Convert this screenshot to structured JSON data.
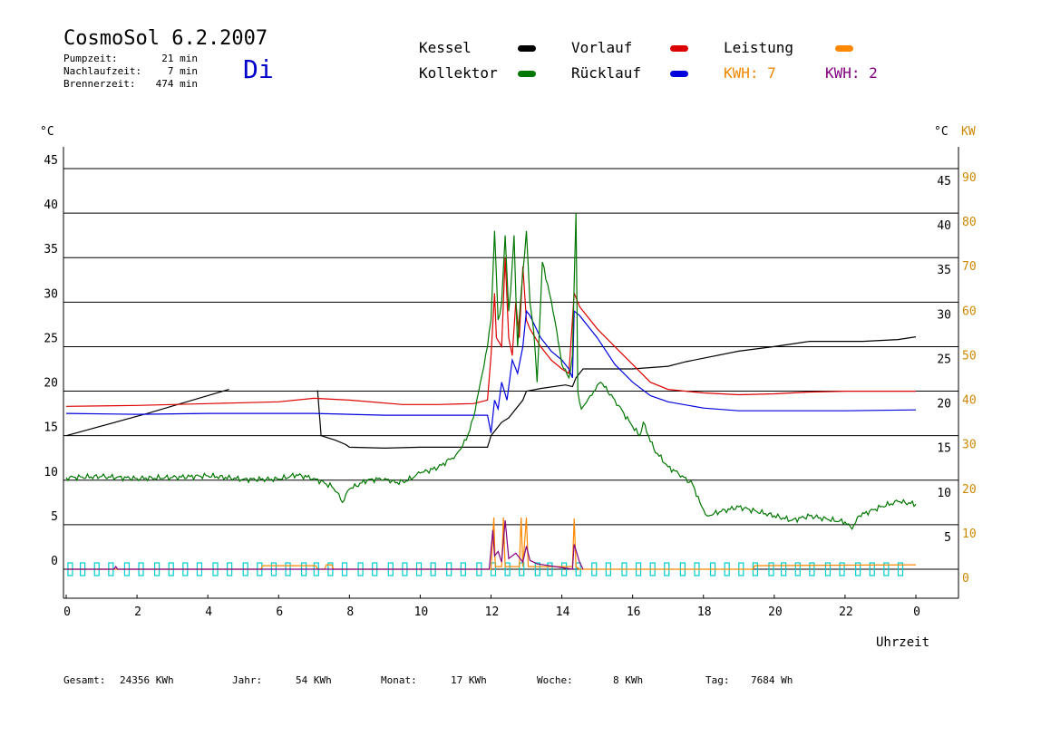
{
  "header": {
    "title": "CosmoSol 6.2.2007",
    "day": "Di",
    "stats": [
      {
        "label": "Pumpzeit:",
        "value": "21 min"
      },
      {
        "label": "Nachlaufzeit:",
        "value": "7 min"
      },
      {
        "label": "Brennerzeit:",
        "value": "474 min"
      }
    ]
  },
  "legend": {
    "items": [
      {
        "label": "Kessel",
        "color": "#000000"
      },
      {
        "label": "Vorlauf",
        "color": "#dd0000"
      },
      {
        "label": "Leistung",
        "color": "#ff8800"
      },
      {
        "label": "Kollektor",
        "color": "#007700"
      },
      {
        "label": "Rücklauf",
        "color": "#0000dd"
      }
    ],
    "kwh1": "KWH: 7",
    "kwh1_color": "#ee8800",
    "kwh2": "KWH: 2",
    "kwh2_color": "#800080"
  },
  "footer": [
    {
      "label": "Gesamt:",
      "value": "24356 KWh"
    },
    {
      "label": "Jahr:",
      "value": "54 KWh"
    },
    {
      "label": "Monat:",
      "value": "17 KWh"
    },
    {
      "label": "Woche:",
      "value": "8 KWh"
    },
    {
      "label": "Tag:",
      "value": "7684 Wh"
    }
  ],
  "chart_data": {
    "type": "line",
    "xlabel": "Uhrzeit",
    "ylabel_left": "°C",
    "ylabel_right": "°C",
    "ylabel_right2": "KW",
    "xlim": [
      0,
      24
    ],
    "ylim": [
      0,
      45
    ],
    "x_ticks": [
      "0",
      "2",
      "4",
      "6",
      "8",
      "10",
      "12",
      "14",
      "16",
      "18",
      "20",
      "22",
      "0"
    ],
    "y_ticks_left": [
      "0",
      "5",
      "10",
      "15",
      "20",
      "25",
      "30",
      "35",
      "40",
      "45"
    ],
    "y_ticks_right": [
      "5",
      "10",
      "15",
      "20",
      "25",
      "30",
      "35",
      "40",
      "45"
    ],
    "y_ticks_kw": [
      "0",
      "10",
      "20",
      "30",
      "40",
      "50",
      "60",
      "70",
      "80",
      "90"
    ],
    "grid": true,
    "series": [
      {
        "name": "Kessel",
        "color": "#000000",
        "points": [
          [
            0,
            15
          ],
          [
            2.3,
            17.5
          ],
          [
            4.6,
            20.2
          ],
          [
            4.65,
            null
          ],
          [
            7.1,
            20.1
          ],
          [
            7.2,
            15
          ],
          [
            7.6,
            14.5
          ],
          [
            7.9,
            14
          ],
          [
            8.0,
            13.7
          ],
          [
            9,
            13.6
          ],
          [
            10,
            13.7
          ],
          [
            11,
            13.7
          ],
          [
            11.9,
            13.7
          ],
          [
            12.0,
            15
          ],
          [
            12.3,
            16.5
          ],
          [
            12.5,
            17
          ],
          [
            12.9,
            19
          ],
          [
            13.0,
            20
          ],
          [
            13.4,
            20.3
          ],
          [
            14.1,
            20.7
          ],
          [
            14.3,
            20.5
          ],
          [
            14.4,
            21.5
          ],
          [
            14.6,
            22.5
          ],
          [
            16,
            22.5
          ],
          [
            17,
            22.8
          ],
          [
            17.5,
            23.3
          ],
          [
            19,
            24.5
          ],
          [
            20,
            25
          ],
          [
            21,
            25.6
          ],
          [
            22.5,
            25.6
          ],
          [
            23.5,
            25.8
          ],
          [
            24,
            26.1
          ]
        ]
      },
      {
        "name": "Vorlauf",
        "color": "#dd0000",
        "points": [
          [
            0,
            18.3
          ],
          [
            2,
            18.4
          ],
          [
            4,
            18.6
          ],
          [
            6,
            18.8
          ],
          [
            7,
            19.2
          ],
          [
            8,
            19
          ],
          [
            9.5,
            18.5
          ],
          [
            10.5,
            18.5
          ],
          [
            11.5,
            18.6
          ],
          [
            11.9,
            19
          ],
          [
            12.0,
            24
          ],
          [
            12.1,
            31
          ],
          [
            12.15,
            26
          ],
          [
            12.3,
            25
          ],
          [
            12.4,
            35
          ],
          [
            12.5,
            26
          ],
          [
            12.6,
            24
          ],
          [
            12.7,
            30
          ],
          [
            12.8,
            26
          ],
          [
            12.9,
            34
          ],
          [
            13.0,
            28
          ],
          [
            13.1,
            27
          ],
          [
            13.4,
            25
          ],
          [
            13.7,
            23.5
          ],
          [
            14.0,
            22.5
          ],
          [
            14.2,
            22
          ],
          [
            14.35,
            31
          ],
          [
            14.5,
            29.5
          ],
          [
            15,
            27
          ],
          [
            15.5,
            25
          ],
          [
            16,
            23
          ],
          [
            16.5,
            21
          ],
          [
            17,
            20.2
          ],
          [
            18,
            19.8
          ],
          [
            19,
            19.6
          ],
          [
            20,
            19.7
          ],
          [
            21,
            19.9
          ],
          [
            22,
            20
          ],
          [
            24,
            20
          ]
        ]
      },
      {
        "name": "Rücklauf",
        "color": "#0000dd",
        "points": [
          [
            0,
            17.5
          ],
          [
            2,
            17.4
          ],
          [
            4,
            17.5
          ],
          [
            6,
            17.5
          ],
          [
            7,
            17.5
          ],
          [
            8,
            17.4
          ],
          [
            9,
            17.3
          ],
          [
            10,
            17.3
          ],
          [
            11.9,
            17.3
          ],
          [
            12.0,
            15.3
          ],
          [
            12.1,
            19
          ],
          [
            12.2,
            18
          ],
          [
            12.3,
            21
          ],
          [
            12.45,
            19
          ],
          [
            12.6,
            23.5
          ],
          [
            12.75,
            22
          ],
          [
            12.9,
            25
          ],
          [
            13.0,
            29
          ],
          [
            13.1,
            28.5
          ],
          [
            13.4,
            26
          ],
          [
            13.7,
            24.5
          ],
          [
            14.0,
            23.5
          ],
          [
            14.2,
            22.5
          ],
          [
            14.3,
            21.5
          ],
          [
            14.35,
            29
          ],
          [
            14.5,
            28.5
          ],
          [
            15,
            26
          ],
          [
            15.5,
            23
          ],
          [
            16,
            21
          ],
          [
            16.5,
            19.5
          ],
          [
            17,
            18.8
          ],
          [
            18,
            18.1
          ],
          [
            19,
            17.8
          ],
          [
            20,
            17.8
          ],
          [
            22,
            17.8
          ],
          [
            24,
            17.9
          ]
        ]
      },
      {
        "name": "Kollektor",
        "color": "#007700",
        "points": [
          [
            0,
            10.3
          ],
          [
            1,
            10.4
          ],
          [
            2,
            10.2
          ],
          [
            3,
            10.3
          ],
          [
            4,
            10.5
          ],
          [
            5,
            10.1
          ],
          [
            6,
            10.1
          ],
          [
            6.5,
            10.6
          ],
          [
            7,
            10.2
          ],
          [
            7.5,
            9.3
          ],
          [
            7.7,
            8.5
          ],
          [
            7.8,
            7.5
          ],
          [
            8,
            9
          ],
          [
            8.5,
            10
          ],
          [
            9,
            10.2
          ],
          [
            9.3,
            9.7
          ],
          [
            9.6,
            9.9
          ],
          [
            10,
            10.8
          ],
          [
            10.5,
            11.4
          ],
          [
            11,
            12.8
          ],
          [
            11.3,
            14.5
          ],
          [
            11.5,
            17
          ],
          [
            11.7,
            21
          ],
          [
            11.9,
            25
          ],
          [
            12.0,
            28
          ],
          [
            12.1,
            38
          ],
          [
            12.2,
            28
          ],
          [
            12.3,
            30
          ],
          [
            12.4,
            37.5
          ],
          [
            12.5,
            29
          ],
          [
            12.55,
            31
          ],
          [
            12.65,
            37.5
          ],
          [
            12.75,
            25
          ],
          [
            12.85,
            31
          ],
          [
            13.0,
            38
          ],
          [
            13.1,
            30
          ],
          [
            13.2,
            27
          ],
          [
            13.3,
            21
          ],
          [
            13.45,
            34.5
          ],
          [
            13.6,
            32
          ],
          [
            13.8,
            28
          ],
          [
            14.0,
            23
          ],
          [
            14.2,
            21.5
          ],
          [
            14.3,
            24
          ],
          [
            14.4,
            40
          ],
          [
            14.45,
            20
          ],
          [
            14.55,
            18
          ],
          [
            14.8,
            19.5
          ],
          [
            15.1,
            21
          ],
          [
            15.5,
            19
          ],
          [
            16,
            16
          ],
          [
            16.2,
            15
          ],
          [
            16.3,
            16.5
          ],
          [
            16.6,
            13.5
          ],
          [
            17,
            11.5
          ],
          [
            17.4,
            10.5
          ],
          [
            17.7,
            9.5
          ],
          [
            17.9,
            7.5
          ],
          [
            18.1,
            6
          ],
          [
            18.5,
            6.5
          ],
          [
            19,
            7
          ],
          [
            19.5,
            6.5
          ],
          [
            20,
            6
          ],
          [
            20.5,
            5.5
          ],
          [
            21,
            6
          ],
          [
            21.5,
            5.6
          ],
          [
            22,
            5.3
          ],
          [
            22.2,
            4.5
          ],
          [
            22.4,
            6
          ],
          [
            23,
            7
          ],
          [
            23.5,
            7.6
          ],
          [
            24,
            7.3
          ]
        ]
      },
      {
        "name": "Leistung",
        "color": "#ff8800",
        "points": [
          [
            0,
            0
          ],
          [
            5.5,
            0
          ],
          [
            5.55,
            0.4
          ],
          [
            7.05,
            0.4
          ],
          [
            7.1,
            0
          ],
          [
            7.3,
            0
          ],
          [
            7.35,
            0.5
          ],
          [
            7.5,
            0.5
          ],
          [
            7.55,
            0
          ],
          [
            12.0,
            0
          ],
          [
            12.08,
            5.8
          ],
          [
            12.12,
            0.3
          ],
          [
            12.3,
            0.3
          ],
          [
            12.35,
            5.8
          ],
          [
            12.4,
            0.3
          ],
          [
            12.8,
            0.3
          ],
          [
            12.85,
            5.8
          ],
          [
            12.9,
            0.3
          ],
          [
            13.0,
            5.8
          ],
          [
            13.05,
            0.3
          ],
          [
            14.3,
            0.3
          ],
          [
            14.35,
            5.7
          ],
          [
            14.4,
            0.3
          ],
          [
            14.5,
            0
          ],
          [
            19.4,
            0
          ],
          [
            19.45,
            0.4
          ],
          [
            24,
            0.5
          ]
        ]
      },
      {
        "name": "Pumpe",
        "color": "#800080",
        "points": [
          [
            0,
            0
          ],
          [
            1.35,
            0
          ],
          [
            1.4,
            0.3
          ],
          [
            1.45,
            0
          ],
          [
            11.95,
            0
          ],
          [
            12.05,
            4.4
          ],
          [
            12.1,
            1.5
          ],
          [
            12.2,
            2
          ],
          [
            12.3,
            0.8
          ],
          [
            12.4,
            5.5
          ],
          [
            12.5,
            1.2
          ],
          [
            12.7,
            1.8
          ],
          [
            12.9,
            0.8
          ],
          [
            13.0,
            2.6
          ],
          [
            13.1,
            1
          ],
          [
            13.3,
            0.6
          ],
          [
            14.3,
            0
          ],
          [
            14.35,
            2.8
          ],
          [
            14.5,
            0.8
          ],
          [
            14.6,
            0
          ]
        ]
      }
    ]
  }
}
